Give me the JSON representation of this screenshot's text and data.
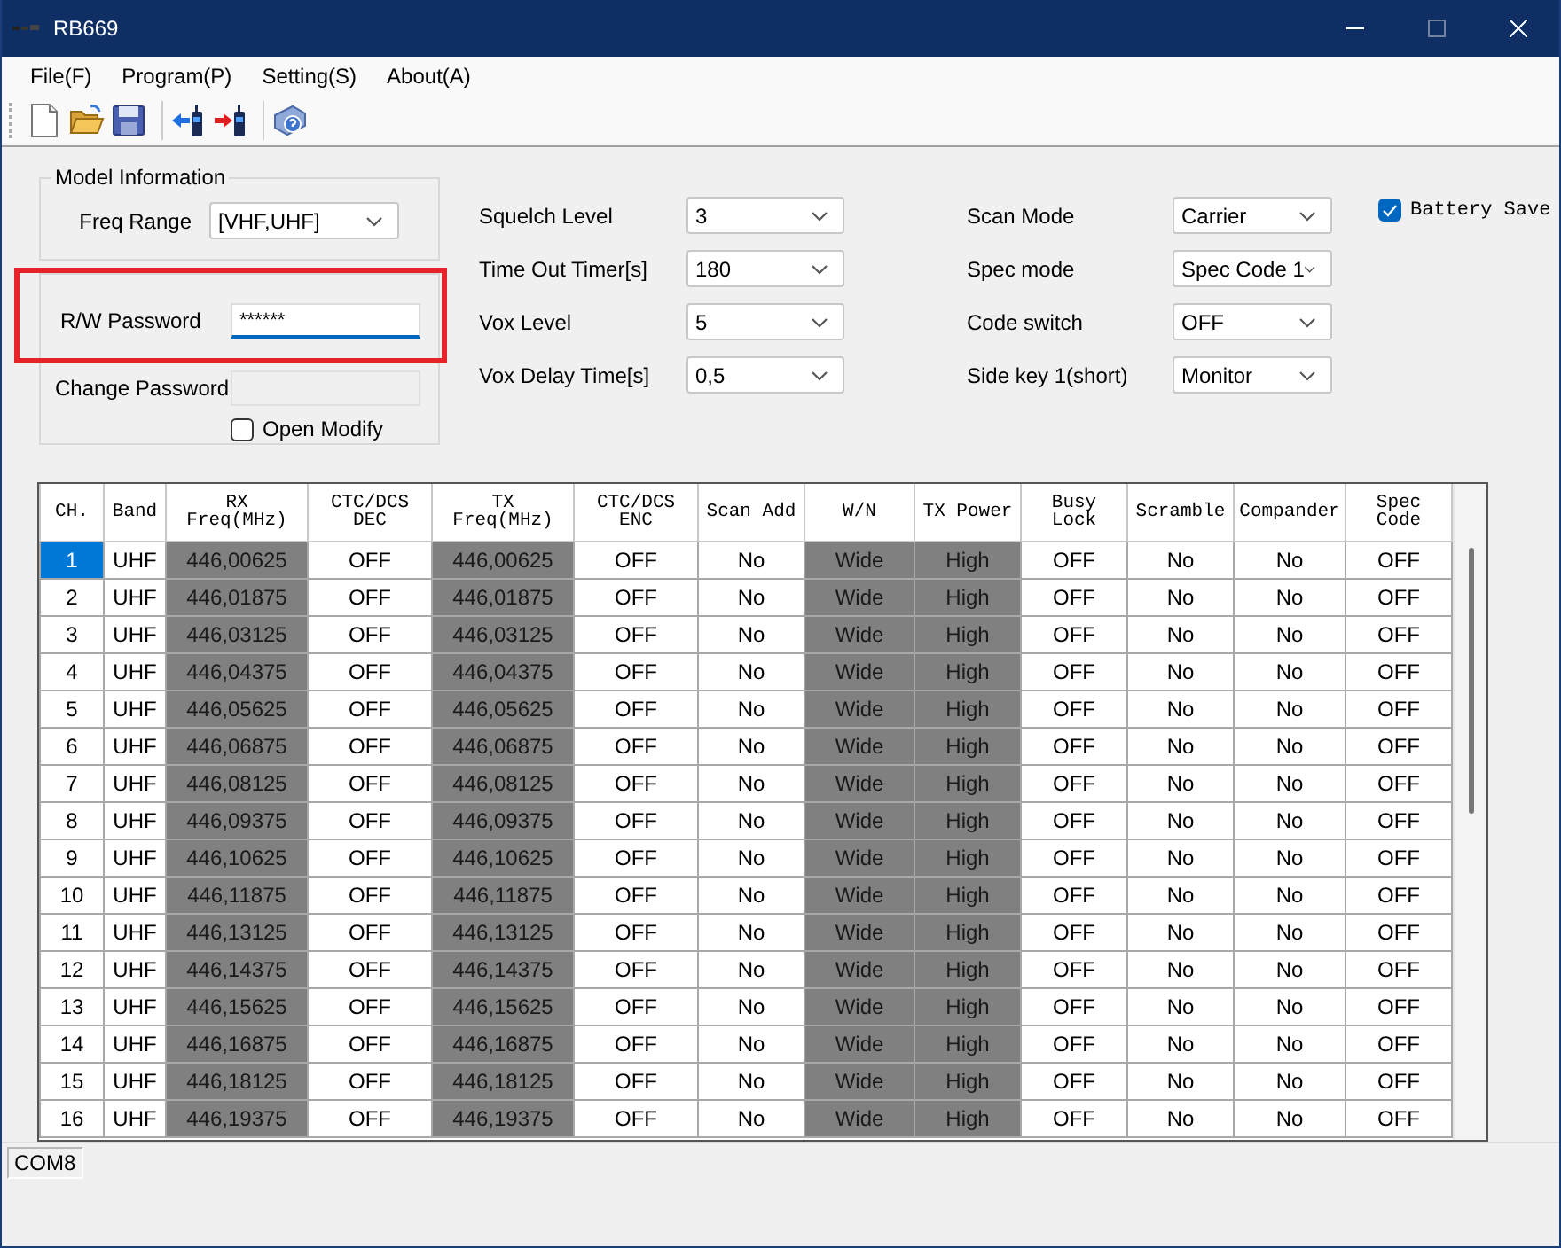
{
  "window": {
    "title": "RB669"
  },
  "menu": [
    "File(F)",
    "Program(P)",
    "Setting(S)",
    "About(A)"
  ],
  "model_information": {
    "title": "Model Information",
    "freq_range": {
      "label": "Freq Range",
      "value": "[VHF,UHF]"
    }
  },
  "password": {
    "label": "R/W Password",
    "value": "******",
    "focused": true,
    "highlighted": true
  },
  "change_password": {
    "label": "Change Password",
    "disabled": true
  },
  "open_modify": {
    "label": "Open Modify",
    "checked": false
  },
  "settings": {
    "left": [
      {
        "label": "Squelch Level",
        "value": "3"
      },
      {
        "label": "Time Out Timer[s]",
        "value": "180"
      },
      {
        "label": "Vox Level",
        "value": "5"
      },
      {
        "label": "Vox Delay Time[s]",
        "value": "0,5"
      }
    ],
    "right": [
      {
        "label": "Scan Mode",
        "value": "Carrier"
      },
      {
        "label": "Spec mode",
        "value": "Spec Code 1"
      },
      {
        "label": "Code switch",
        "value": "OFF"
      },
      {
        "label": "Side key 1(short)",
        "value": "Monitor"
      }
    ]
  },
  "battery_save": {
    "label": "Battery Save",
    "checked": true
  },
  "table": {
    "columns": [
      {
        "label": "CH.",
        "shaded": false
      },
      {
        "label": "Band",
        "shaded": false
      },
      {
        "label": "RX\nFreq(MHz)",
        "shaded": true
      },
      {
        "label": "CTC/DCS\nDEC",
        "shaded": false
      },
      {
        "label": "TX\nFreq(MHz)",
        "shaded": true
      },
      {
        "label": "CTC/DCS\nENC",
        "shaded": false
      },
      {
        "label": "Scan Add",
        "shaded": false
      },
      {
        "label": "W/N",
        "shaded": true
      },
      {
        "label": "TX Power",
        "shaded": true
      },
      {
        "label": "Busy\nLock",
        "shaded": false
      },
      {
        "label": "Scramble",
        "shaded": false
      },
      {
        "label": "Compander",
        "shaded": false
      },
      {
        "label": "Spec\nCode",
        "shaded": false
      }
    ],
    "rows": [
      {
        "selected": true,
        "cells": [
          "1",
          "UHF",
          "446,00625",
          "OFF",
          "446,00625",
          "OFF",
          "No",
          "Wide",
          "High",
          "OFF",
          "No",
          "No",
          "OFF"
        ]
      },
      {
        "selected": false,
        "cells": [
          "2",
          "UHF",
          "446,01875",
          "OFF",
          "446,01875",
          "OFF",
          "No",
          "Wide",
          "High",
          "OFF",
          "No",
          "No",
          "OFF"
        ]
      },
      {
        "selected": false,
        "cells": [
          "3",
          "UHF",
          "446,03125",
          "OFF",
          "446,03125",
          "OFF",
          "No",
          "Wide",
          "High",
          "OFF",
          "No",
          "No",
          "OFF"
        ]
      },
      {
        "selected": false,
        "cells": [
          "4",
          "UHF",
          "446,04375",
          "OFF",
          "446,04375",
          "OFF",
          "No",
          "Wide",
          "High",
          "OFF",
          "No",
          "No",
          "OFF"
        ]
      },
      {
        "selected": false,
        "cells": [
          "5",
          "UHF",
          "446,05625",
          "OFF",
          "446,05625",
          "OFF",
          "No",
          "Wide",
          "High",
          "OFF",
          "No",
          "No",
          "OFF"
        ]
      },
      {
        "selected": false,
        "cells": [
          "6",
          "UHF",
          "446,06875",
          "OFF",
          "446,06875",
          "OFF",
          "No",
          "Wide",
          "High",
          "OFF",
          "No",
          "No",
          "OFF"
        ]
      },
      {
        "selected": false,
        "cells": [
          "7",
          "UHF",
          "446,08125",
          "OFF",
          "446,08125",
          "OFF",
          "No",
          "Wide",
          "High",
          "OFF",
          "No",
          "No",
          "OFF"
        ]
      },
      {
        "selected": false,
        "cells": [
          "8",
          "UHF",
          "446,09375",
          "OFF",
          "446,09375",
          "OFF",
          "No",
          "Wide",
          "High",
          "OFF",
          "No",
          "No",
          "OFF"
        ]
      },
      {
        "selected": false,
        "cells": [
          "9",
          "UHF",
          "446,10625",
          "OFF",
          "446,10625",
          "OFF",
          "No",
          "Wide",
          "High",
          "OFF",
          "No",
          "No",
          "OFF"
        ]
      },
      {
        "selected": false,
        "cells": [
          "10",
          "UHF",
          "446,11875",
          "OFF",
          "446,11875",
          "OFF",
          "No",
          "Wide",
          "High",
          "OFF",
          "No",
          "No",
          "OFF"
        ]
      },
      {
        "selected": false,
        "cells": [
          "11",
          "UHF",
          "446,13125",
          "OFF",
          "446,13125",
          "OFF",
          "No",
          "Wide",
          "High",
          "OFF",
          "No",
          "No",
          "OFF"
        ]
      },
      {
        "selected": false,
        "cells": [
          "12",
          "UHF",
          "446,14375",
          "OFF",
          "446,14375",
          "OFF",
          "No",
          "Wide",
          "High",
          "OFF",
          "No",
          "No",
          "OFF"
        ]
      },
      {
        "selected": false,
        "cells": [
          "13",
          "UHF",
          "446,15625",
          "OFF",
          "446,15625",
          "OFF",
          "No",
          "Wide",
          "High",
          "OFF",
          "No",
          "No",
          "OFF"
        ]
      },
      {
        "selected": false,
        "cells": [
          "14",
          "UHF",
          "446,16875",
          "OFF",
          "446,16875",
          "OFF",
          "No",
          "Wide",
          "High",
          "OFF",
          "No",
          "No",
          "OFF"
        ]
      },
      {
        "selected": false,
        "cells": [
          "15",
          "UHF",
          "446,18125",
          "OFF",
          "446,18125",
          "OFF",
          "No",
          "Wide",
          "High",
          "OFF",
          "No",
          "No",
          "OFF"
        ]
      },
      {
        "selected": false,
        "cells": [
          "16",
          "UHF",
          "446,19375",
          "OFF",
          "446,19375",
          "OFF",
          "No",
          "Wide",
          "High",
          "OFF",
          "No",
          "No",
          "OFF"
        ]
      }
    ]
  },
  "status_bar": {
    "port": "COM8"
  }
}
